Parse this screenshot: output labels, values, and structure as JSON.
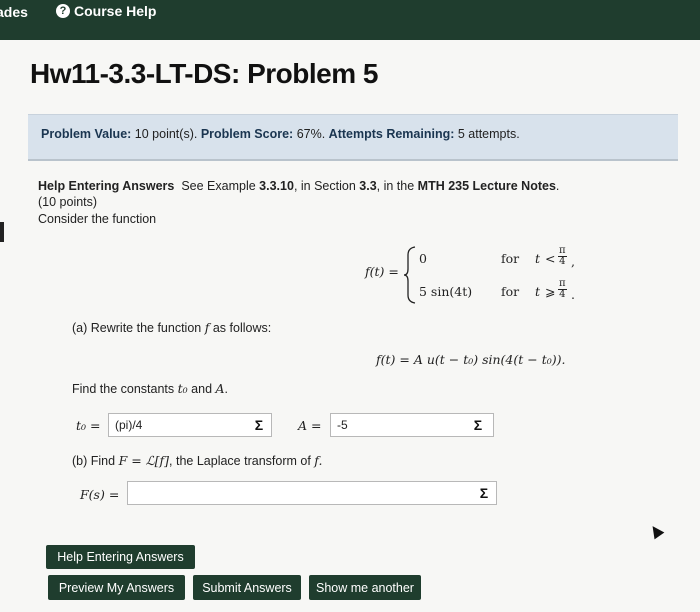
{
  "nav": {
    "grades_label": "ades",
    "help_icon": "?",
    "help_label": "Course Help"
  },
  "title": "Hw11-3.3-LT-DS: Problem 5",
  "info": {
    "value_label": "Problem Value:",
    "value": "10 point(s).",
    "score_label": "Problem Score:",
    "score": "67%.",
    "attempts_label": "Attempts Remaining:",
    "attempts": "5 attempts."
  },
  "problem": {
    "help_label": "Help Entering Answers",
    "see_prefix": "See Example",
    "example": "3.3.10",
    "in_section": ", in Section",
    "section": "3.3",
    "in_the": ", in the",
    "notes": "MTH 235 Lecture Notes",
    "period": ".",
    "points": "(10 points)",
    "consider": "Consider the function",
    "f_of_t": "f(t) =",
    "case1_value": "0",
    "case2_value": "5 sin(4t)",
    "for_label": "for",
    "t_var": "t",
    "lt": "<",
    "ge": "⩾",
    "pi": "π",
    "four": "4",
    "comma": ",",
    "dot": ".",
    "part_a": "(a) Rewrite the function",
    "part_a_f": "f",
    "part_a_end": "as follows:",
    "rewrite_formula": "f(t) = A u(t − t₀) sin(4(t − t₀)).",
    "find_constants_prefix": "Find the constants",
    "t0": "t₀",
    "and": "and",
    "A_var": "A",
    "t0_label": "t₀ =",
    "t0_value": "(pi)/4",
    "A_label": "A =",
    "A_value": "-5",
    "part_b_prefix": "(b) Find",
    "part_b_formula": "F = ℒ[f]",
    "part_b_suffix": ", the Laplace transform of",
    "part_b_f": "f.",
    "Fs_label": "F(s) =",
    "Fs_value": "",
    "sigma": "Σ"
  },
  "buttons": {
    "help": "Help Entering Answers",
    "preview": "Preview My Answers",
    "submit": "Submit Answers",
    "another": "Show me another"
  }
}
